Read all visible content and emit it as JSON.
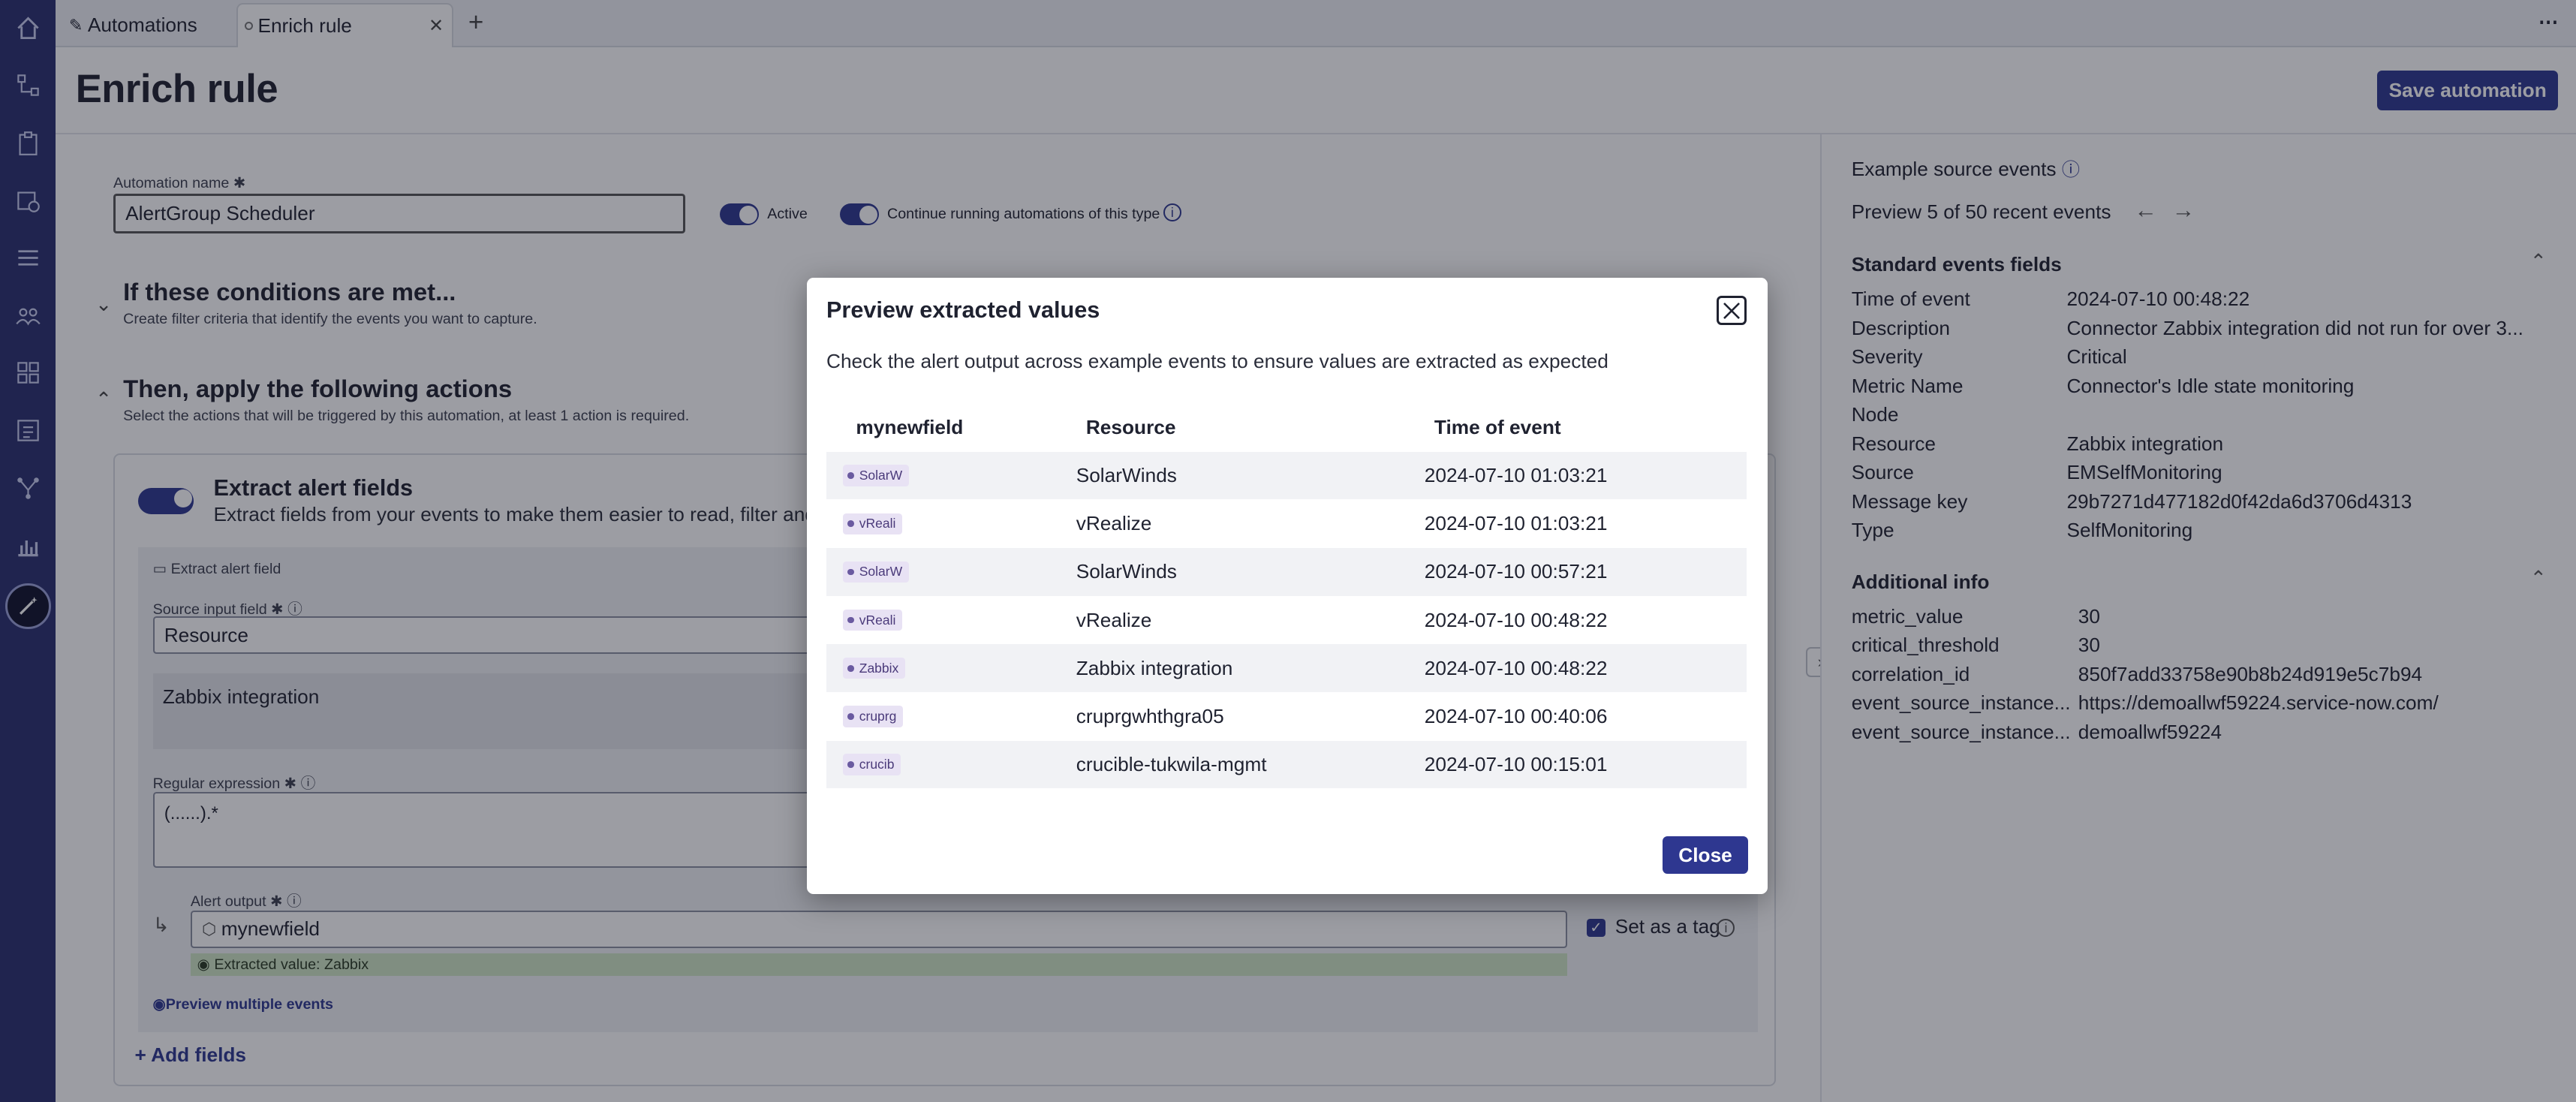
{
  "tabs": [
    {
      "label": "Automations",
      "icon": "pencil-icon"
    },
    {
      "label": "Enrich rule",
      "icon": "unsaved-dot-icon"
    }
  ],
  "page": {
    "title": "Enrich rule",
    "save_label": "Save automation"
  },
  "form": {
    "name_label": "Automation name",
    "name_value": "AlertGroup Scheduler",
    "active_label": "Active",
    "continue_label": "Continue running automations of this type",
    "conditions_title": "If these conditions are met...",
    "conditions_sub": "Create filter criteria that identify the events you want to capture.",
    "actions_title": "Then, apply the following actions",
    "actions_sub": "Select the actions that will be triggered by this automation, at least 1 action is required.",
    "extract_title": "Extract alert fields",
    "extract_sub": "Extract fields from your events to make them easier to read, filter and p",
    "extract_field_label": "Extract alert field",
    "source_label": "Source input field",
    "source_value": "Resource",
    "source_preview": "Zabbix integration",
    "regex_label": "Regular expression",
    "regex_value": "(......).*",
    "output_label": "Alert output",
    "output_value": "mynewfield",
    "extracted_value": "Extracted value: Zabbix",
    "set_tag_label": "Set as a tag",
    "preview_link": "Preview multiple events",
    "add_fields": "Add fields"
  },
  "right_panel": {
    "title": "Example source events",
    "preview_text": "Preview 5 of 50 recent events",
    "standard_title": "Standard events fields",
    "standard_fields": [
      {
        "key": "Time of event",
        "value": "2024-07-10 00:48:22"
      },
      {
        "key": "Description",
        "value": "Connector Zabbix integration did not run for over 3..."
      },
      {
        "key": "Severity",
        "value": "Critical"
      },
      {
        "key": "Metric Name",
        "value": "Connector's Idle state monitoring"
      },
      {
        "key": "Node",
        "value": ""
      },
      {
        "key": "Resource",
        "value": "Zabbix integration"
      },
      {
        "key": "Source",
        "value": "EMSelfMonitoring"
      },
      {
        "key": "Message key",
        "value": "29b7271d477182d0f42da6d3706d4313"
      },
      {
        "key": "Type",
        "value": "SelfMonitoring"
      }
    ],
    "additional_title": "Additional info",
    "additional_fields": [
      {
        "key": "metric_value",
        "value": "30"
      },
      {
        "key": "critical_threshold",
        "value": "30"
      },
      {
        "key": "correlation_id",
        "value": "850f7add33758e90b8b24d919e5c7b94"
      },
      {
        "key": "event_source_instance...",
        "value": "https://demoallwf59224.service-now.com/"
      },
      {
        "key": "event_source_instance...",
        "value": "demoallwf59224"
      }
    ]
  },
  "modal": {
    "title": "Preview extracted values",
    "description": "Check the alert output across example events to ensure values are extracted as expected",
    "columns": [
      "mynewfield",
      "Resource",
      "Time of event"
    ],
    "rows": [
      {
        "tag": "SolarW",
        "resource": "SolarWinds",
        "time": "2024-07-10 01:03:21"
      },
      {
        "tag": "vReali",
        "resource": "vRealize",
        "time": "2024-07-10 01:03:21"
      },
      {
        "tag": "SolarW",
        "resource": "SolarWinds",
        "time": "2024-07-10 00:57:21"
      },
      {
        "tag": "vReali",
        "resource": "vRealize",
        "time": "2024-07-10 00:48:22"
      },
      {
        "tag": "Zabbix",
        "resource": "Zabbix integration",
        "time": "2024-07-10 00:48:22"
      },
      {
        "tag": "cruprg",
        "resource": "cruprgwhthgra05",
        "time": "2024-07-10 00:40:06"
      },
      {
        "tag": "crucib",
        "resource": "crucible-tukwila-mgmt",
        "time": "2024-07-10 00:15:01"
      }
    ],
    "close_label": "Close"
  },
  "colors": {
    "primary": "#2e3790",
    "rail": "#2a2f6e",
    "chip_bg": "#e8e2f4",
    "extracted_bg": "#cfe6c4"
  }
}
